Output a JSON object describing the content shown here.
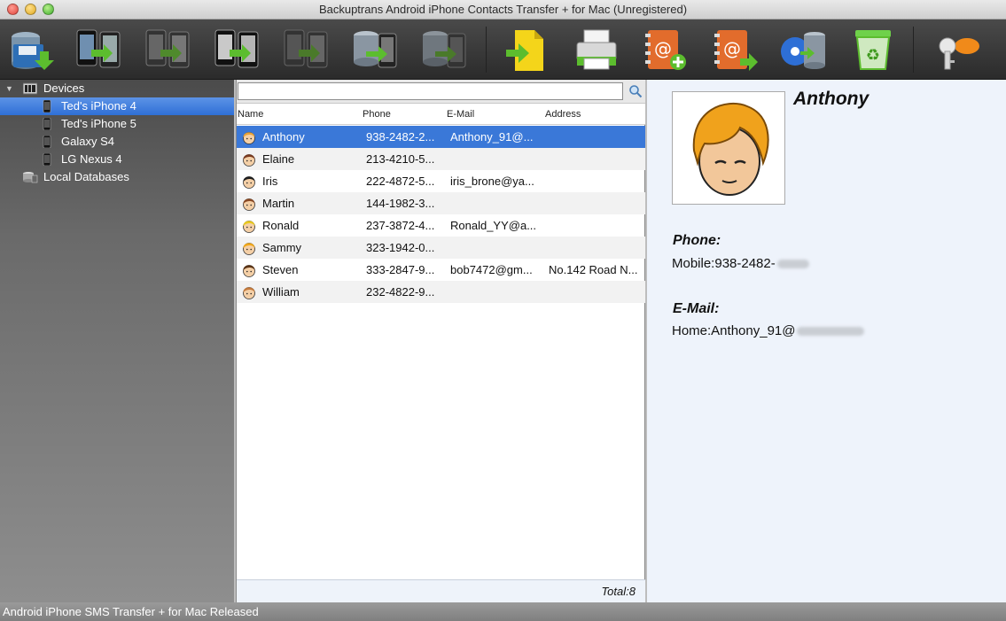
{
  "window": {
    "title": "Backuptrans Android iPhone Contacts Transfer + for Mac (Unregistered)"
  },
  "toolbar": {
    "buttons": [
      {
        "icon": "save-backup-icon"
      },
      {
        "icon": "transfer-phone-to-phone-icon"
      },
      {
        "icon": "transfer-phone-to-phone-gray-icon"
      },
      {
        "icon": "transfer-phone-to-phone-all-icon"
      },
      {
        "icon": "transfer-phone-to-phone-dim-icon"
      },
      {
        "icon": "database-to-phone-icon"
      },
      {
        "icon": "database-to-phone-dim-icon"
      },
      {
        "icon": "export-file-icon"
      },
      {
        "icon": "print-icon"
      },
      {
        "icon": "add-contact-icon"
      },
      {
        "icon": "export-contact-icon"
      },
      {
        "icon": "itunes-import-icon"
      },
      {
        "icon": "recycle-bin-icon"
      },
      {
        "icon": "register-key-icon"
      }
    ]
  },
  "sidebar": {
    "devices_label": "Devices",
    "devices": [
      {
        "label": "Ted's iPhone 4",
        "selected": true
      },
      {
        "label": "Ted's iPhone 5",
        "selected": false
      },
      {
        "label": "Galaxy S4",
        "selected": false
      },
      {
        "label": "LG Nexus 4",
        "selected": false
      }
    ],
    "local_databases_label": "Local Databases"
  },
  "contacts": {
    "search": {
      "value": "",
      "placeholder": ""
    },
    "columns": {
      "name": "Name",
      "phone": "Phone",
      "email": "E-Mail",
      "address": "Address"
    },
    "rows": [
      {
        "name": "Anthony",
        "phone": "938-2482-2...",
        "email": "Anthony_91@...",
        "address": "",
        "avatar_color": "#e8a33a",
        "selected": true
      },
      {
        "name": "Elaine",
        "phone": "213-4210-5...",
        "email": "",
        "address": "",
        "avatar_color": "#7a3b20",
        "selected": false
      },
      {
        "name": "Iris",
        "phone": "222-4872-5...",
        "email": "iris_brone@ya...",
        "address": "",
        "avatar_color": "#1e1e1e",
        "selected": false
      },
      {
        "name": "Martin",
        "phone": "144-1982-3...",
        "email": "",
        "address": "",
        "avatar_color": "#8a4a25",
        "selected": false
      },
      {
        "name": "Ronald",
        "phone": "237-3872-4...",
        "email": "Ronald_YY@a...",
        "address": "",
        "avatar_color": "#e9c91f",
        "selected": false
      },
      {
        "name": "Sammy",
        "phone": "323-1942-0...",
        "email": "",
        "address": "",
        "avatar_color": "#f0a81a",
        "selected": false
      },
      {
        "name": "Steven",
        "phone": "333-2847-9...",
        "email": "bob7472@gm...",
        "address": "No.142 Road N...",
        "avatar_color": "#5b3416",
        "selected": false
      },
      {
        "name": "William",
        "phone": "232-4822-9...",
        "email": "",
        "address": "",
        "avatar_color": "#c47a3c",
        "selected": false
      }
    ],
    "total": "Total:8"
  },
  "detail": {
    "name": "Anthony",
    "phone_heading": "Phone:",
    "phone_value": "Mobile:938-2482-",
    "email_heading": "E-Mail:",
    "email_value": "Home:Anthony_91@"
  },
  "status": {
    "text": "Android iPhone SMS Transfer + for Mac Released"
  }
}
